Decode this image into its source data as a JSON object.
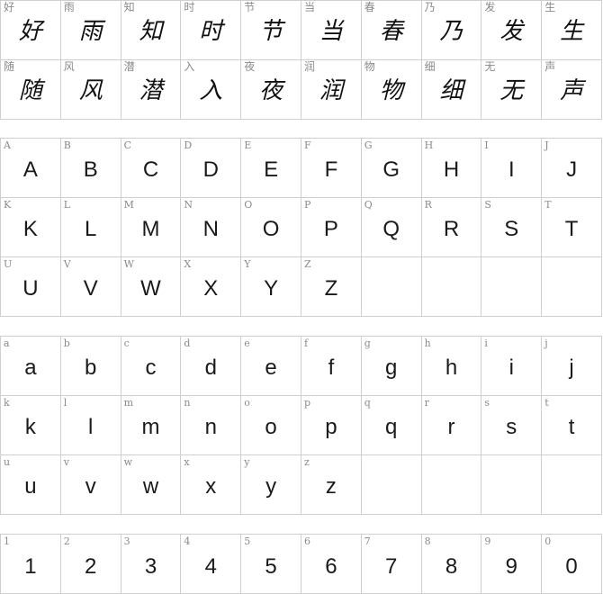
{
  "cjk": [
    "好",
    "雨",
    "知",
    "时",
    "节",
    "当",
    "春",
    "乃",
    "发",
    "生",
    "随",
    "风",
    "潜",
    "入",
    "夜",
    "润",
    "物",
    "细",
    "无",
    "声"
  ],
  "upper": [
    "A",
    "B",
    "C",
    "D",
    "E",
    "F",
    "G",
    "H",
    "I",
    "J",
    "K",
    "L",
    "M",
    "N",
    "O",
    "P",
    "Q",
    "R",
    "S",
    "T",
    "U",
    "V",
    "W",
    "X",
    "Y",
    "Z",
    "",
    "",
    "",
    ""
  ],
  "lower": [
    "a",
    "b",
    "c",
    "d",
    "e",
    "f",
    "g",
    "h",
    "i",
    "j",
    "k",
    "l",
    "m",
    "n",
    "o",
    "p",
    "q",
    "r",
    "s",
    "t",
    "u",
    "v",
    "w",
    "x",
    "y",
    "z",
    "",
    "",
    "",
    ""
  ],
  "digits": [
    "1",
    "2",
    "3",
    "4",
    "5",
    "6",
    "7",
    "8",
    "9",
    "0"
  ]
}
